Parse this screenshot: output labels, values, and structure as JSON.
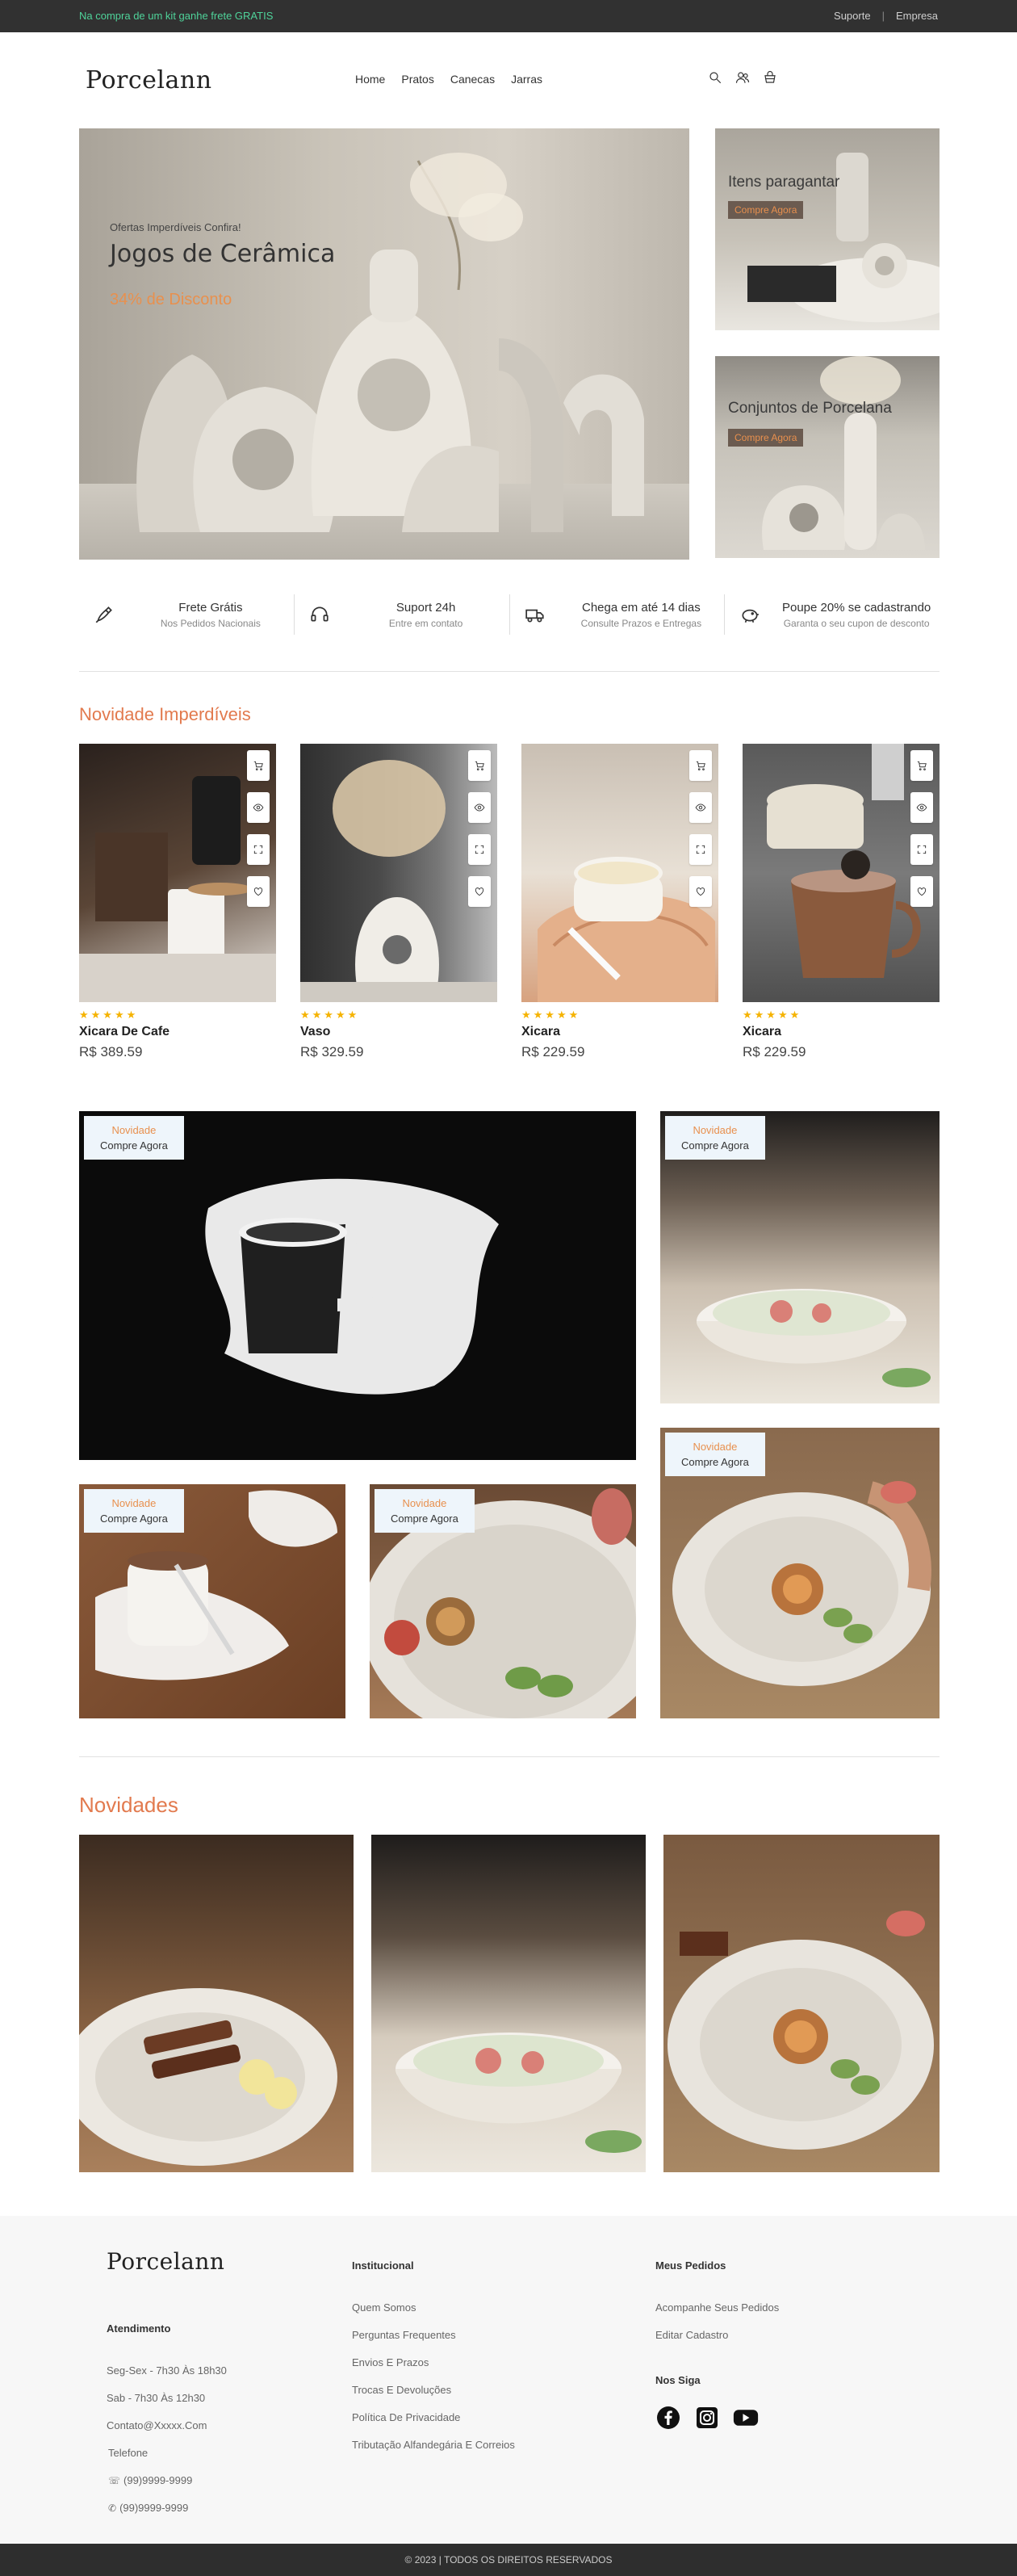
{
  "topbar": {
    "promo": "Na compra de um kit ganhe frete GRATIS",
    "links": [
      "Suporte",
      "|",
      "Empresa"
    ]
  },
  "header": {
    "logo": "Porcelann",
    "nav": [
      "Home",
      "Pratos",
      "Canecas",
      "Jarras"
    ],
    "icons": [
      "search-icon",
      "user-icon",
      "cart-icon"
    ]
  },
  "hero": {
    "kicker": "Ofertas Imperdíveis Confira!",
    "title": "Jogos de Cerâmica",
    "discount": "34% de Disconto"
  },
  "side_cards": [
    {
      "label": "Itens paragantar",
      "button": "Compre Agora"
    },
    {
      "label": "Conjuntos de Porcelana",
      "button": "Compre Agora"
    }
  ],
  "features": [
    {
      "icon": "rocket-icon",
      "title": "Frete Grátis",
      "subtitle": "Nos Pedidos Nacionais"
    },
    {
      "icon": "headset-icon",
      "title": "Suport 24h",
      "subtitle": "Entre em contato"
    },
    {
      "icon": "truck-icon",
      "title": "Chega em até 14 dias",
      "subtitle": "Consulte Prazos e Entregas"
    },
    {
      "icon": "piggy-bank-icon",
      "title": "Poupe 20% se cadastrando",
      "subtitle": "Garanta o seu cupon de desconto"
    }
  ],
  "products_section": {
    "title": "Novidade Imperdíveis",
    "items": [
      {
        "name": "Xicara De Cafe",
        "price": "R$ 389.59",
        "rating": 5
      },
      {
        "name": "Vaso",
        "price": "R$ 329.59",
        "rating": 5
      },
      {
        "name": "Xicara",
        "price": "R$ 229.59",
        "rating": 5
      },
      {
        "name": "Xicara",
        "price": "R$ 229.59",
        "rating": 5
      }
    ],
    "stars": "★★★★★",
    "action_icons": [
      "cart-icon",
      "eye-icon",
      "expand-icon",
      "heart-icon"
    ]
  },
  "gallery": {
    "badge_new": "Novidade",
    "badge_cta": "Compre Agora"
  },
  "novidades": {
    "title": "Novidades"
  },
  "footer": {
    "logo": "Porcelann",
    "atendimento": {
      "title": "Atendimento",
      "lines": [
        "Seg-Sex - 7h30 Às 18h30",
        "Sab - 7h30 Às 12h30",
        "Contato@Xxxxx.Com",
        "Telefone"
      ],
      "whatsapp": "(99)9999-9999",
      "phone": "(99)9999-9999"
    },
    "institucional": {
      "title": "Institucional",
      "links": [
        "Quem Somos",
        "Perguntas Frequentes",
        "Envios E Prazos",
        "Trocas E Devoluções",
        "Política De Privacidade",
        "Tributação Alfandegária E Correios"
      ]
    },
    "pedidos": {
      "title": "Meus Pedidos",
      "links": [
        "Acompanhe Seus Pedidos",
        "Editar Cadastro"
      ]
    },
    "social": {
      "title": "Nos Siga",
      "icons": [
        "facebook-icon",
        "instagram-icon",
        "youtube-icon"
      ]
    },
    "copyright": "© 2023  |  TODOS OS DIREITOS RESERVADOS"
  }
}
